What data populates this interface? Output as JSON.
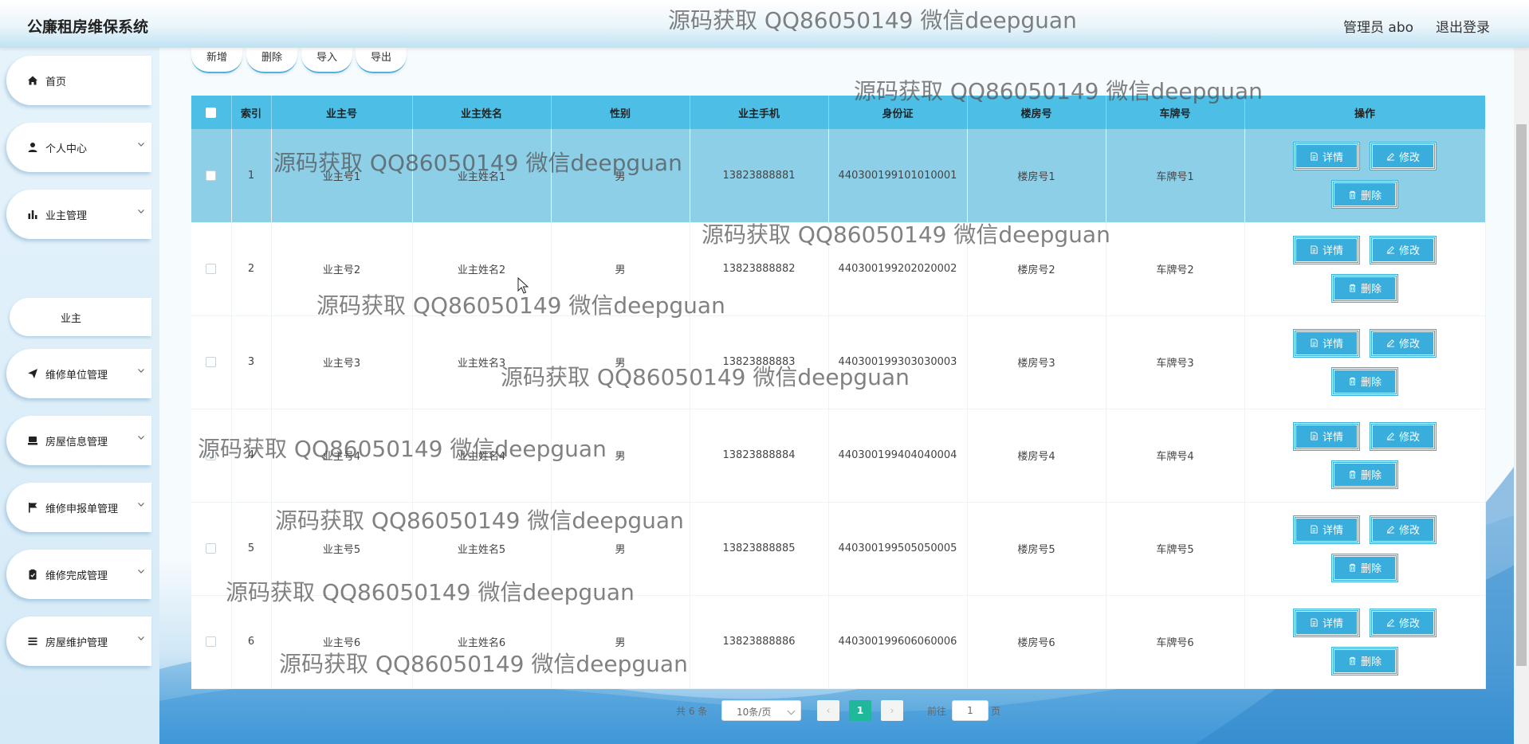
{
  "header": {
    "app_title": "公廉租房维保系统",
    "user_label": "管理员 abo",
    "logout_label": "退出登录"
  },
  "sidebar": {
    "items": [
      {
        "label": "首页",
        "icon": "home-icon"
      },
      {
        "label": "个人中心",
        "icon": "user-icon"
      },
      {
        "label": "业主管理",
        "icon": "bar-chart-icon"
      },
      {
        "label": "维修单位管理",
        "icon": "paper-plane-icon"
      },
      {
        "label": "房屋信息管理",
        "icon": "house-icon"
      },
      {
        "label": "维修申报单管理",
        "icon": "flag-icon"
      },
      {
        "label": "维修完成管理",
        "icon": "clipboard-icon"
      },
      {
        "label": "房屋维护管理",
        "icon": "list-icon"
      }
    ],
    "subitem": {
      "label": "业主"
    }
  },
  "toolbar": {
    "add_label": "新增",
    "delete_label": "删除",
    "import_label": "导入",
    "export_label": "导出"
  },
  "table": {
    "columns": [
      "索引",
      "业主号",
      "业主姓名",
      "性别",
      "业主手机",
      "身份证",
      "楼房号",
      "车牌号",
      "操作"
    ],
    "rows": [
      {
        "index": "1",
        "owner_no": "业主号1",
        "owner_name": "业主姓名1",
        "gender": "男",
        "phone": "13823888881",
        "id_card": "440300199101010001",
        "building": "楼房号1",
        "plate": "车牌号1"
      },
      {
        "index": "2",
        "owner_no": "业主号2",
        "owner_name": "业主姓名2",
        "gender": "男",
        "phone": "13823888882",
        "id_card": "440300199202020002",
        "building": "楼房号2",
        "plate": "车牌号2"
      },
      {
        "index": "3",
        "owner_no": "业主号3",
        "owner_name": "业主姓名3",
        "gender": "男",
        "phone": "13823888883",
        "id_card": "440300199303030003",
        "building": "楼房号3",
        "plate": "车牌号3"
      },
      {
        "index": "4",
        "owner_no": "业主号4",
        "owner_name": "业主姓名4",
        "gender": "男",
        "phone": "13823888884",
        "id_card": "440300199404040004",
        "building": "楼房号4",
        "plate": "车牌号4"
      },
      {
        "index": "5",
        "owner_no": "业主号5",
        "owner_name": "业主姓名5",
        "gender": "男",
        "phone": "13823888885",
        "id_card": "440300199505050005",
        "building": "楼房号5",
        "plate": "车牌号5"
      },
      {
        "index": "6",
        "owner_no": "业主号6",
        "owner_name": "业主姓名6",
        "gender": "男",
        "phone": "13823888886",
        "id_card": "440300199606060006",
        "building": "楼房号6",
        "plate": "车牌号6"
      }
    ],
    "actions": {
      "detail": "详情",
      "edit": "修改",
      "delete": "删除"
    }
  },
  "pagination": {
    "total": "共 6 条",
    "page_size": "10条/页",
    "current_page": "1",
    "prev": "‹",
    "next": "›",
    "goto_prefix": "前往",
    "goto_value": "1",
    "goto_suffix": "页"
  },
  "watermark": {
    "text": "源码获取 QQ86050149 微信deepguan"
  },
  "colors": {
    "table_header": "#4dbfe6",
    "selected_row": "#8ecfe8",
    "action_button": "#39aedc",
    "current_page": "#1fb89a"
  }
}
